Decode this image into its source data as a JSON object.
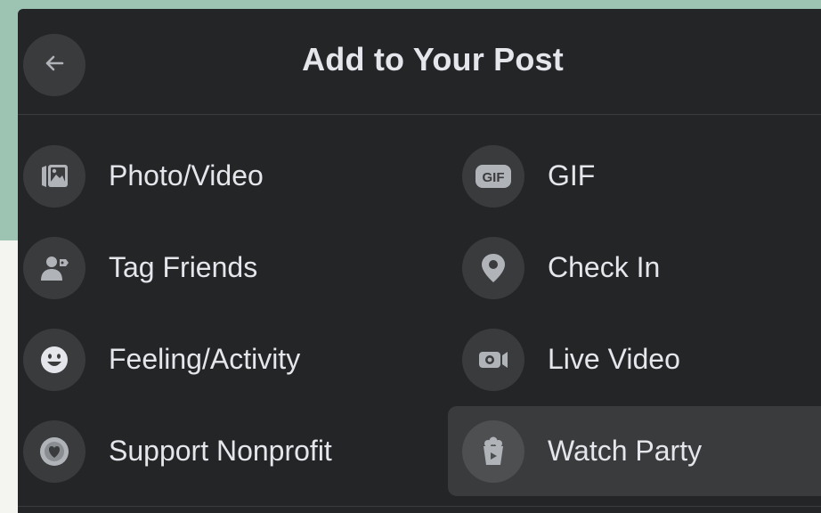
{
  "header": {
    "title": "Add to Your Post",
    "back_icon": "arrow-left-icon"
  },
  "options": [
    {
      "label": "Photo/Video",
      "icon": "photo-video-icon"
    },
    {
      "label": "GIF",
      "icon": "gif-icon"
    },
    {
      "label": "Tag Friends",
      "icon": "tag-friends-icon"
    },
    {
      "label": "Check In",
      "icon": "location-pin-icon"
    },
    {
      "label": "Feeling/Activity",
      "icon": "smiley-icon"
    },
    {
      "label": "Live Video",
      "icon": "video-camera-icon"
    },
    {
      "label": "Support Nonprofit",
      "icon": "heart-coin-icon"
    },
    {
      "label": "Watch Party",
      "icon": "popcorn-icon"
    }
  ],
  "colors": {
    "panel_bg": "#242526",
    "icon_bg": "#3a3b3c",
    "text": "#e4e6eb",
    "icon_glyph": "#b0b3b8",
    "backdrop_green": "#9dc3b3"
  }
}
